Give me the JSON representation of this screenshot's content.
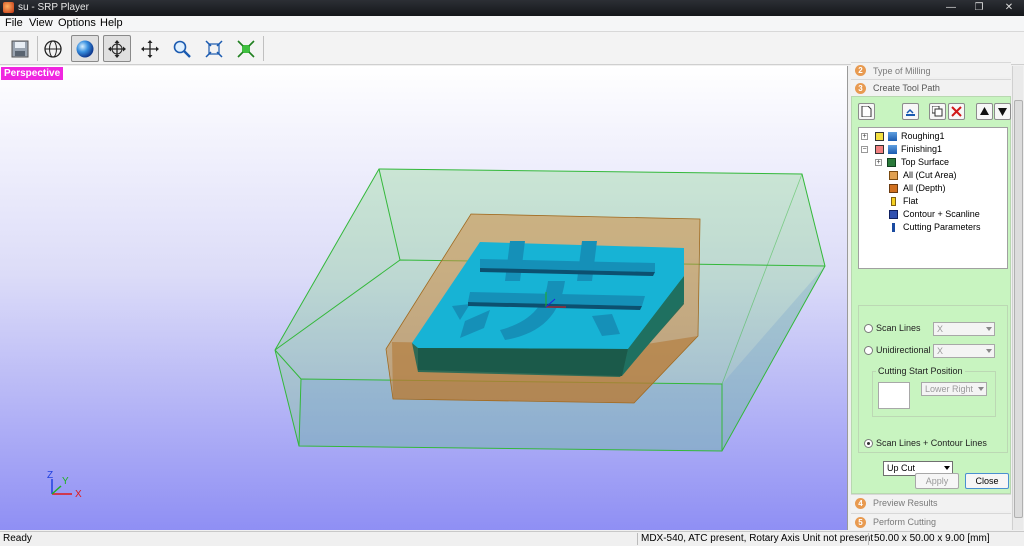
{
  "window": {
    "title": "su - SRP Player",
    "controls": [
      "—",
      "❐",
      "✕"
    ]
  },
  "menu": [
    "File",
    "View",
    "Options",
    "Help"
  ],
  "toolbar": {
    "buttons": [
      "save-icon",
      "globe-icon",
      "sphere-icon",
      "rotate-icon",
      "pan-icon",
      "zoom-icon",
      "fit-icon",
      "fit-selection-icon"
    ]
  },
  "viewport": {
    "label": "Perspective",
    "axis_labels": {
      "x": "X",
      "y": "Y",
      "z": "Z"
    }
  },
  "panel": {
    "steps": [
      {
        "num": "2",
        "label": "Type of Milling"
      },
      {
        "num": "3",
        "label": "Create Tool Path"
      },
      {
        "num": "4",
        "label": "Preview Results"
      },
      {
        "num": "5",
        "label": "Perform Cutting"
      }
    ],
    "tree": [
      {
        "label": "Roughing1"
      },
      {
        "label": "Finishing1"
      },
      {
        "label": "Top Surface"
      },
      {
        "label": "All (Cut Area)"
      },
      {
        "label": "All (Depth)"
      },
      {
        "label": "Flat"
      },
      {
        "label": "Contour + Scanline"
      },
      {
        "label": "Cutting Parameters"
      }
    ],
    "options": {
      "scan_lines": "Scan Lines",
      "scan_lines_value": "X",
      "unidirectional": "Unidirectional",
      "unidirectional_value": "X",
      "cutting_start": "Cutting Start Position",
      "cutting_start_value": "Lower Right",
      "scan_contour": "Scan Lines + Contour Lines",
      "cut_direction": "Up Cut",
      "selected": "Scan Lines + Contour Lines"
    },
    "buttons": {
      "apply": "Apply",
      "close": "Close"
    }
  },
  "status": {
    "left": "Ready",
    "machine": "MDX-540, ATC present, Rotary Axis Unit not present",
    "dimensions": "50.00 x  50.00 x  9.00 [mm]"
  },
  "colors": {
    "label_magenta": "#f026e0",
    "panel_green": "#c8f4c0",
    "model_cyan": "#18b4d4",
    "stock_green": "#40c040"
  }
}
